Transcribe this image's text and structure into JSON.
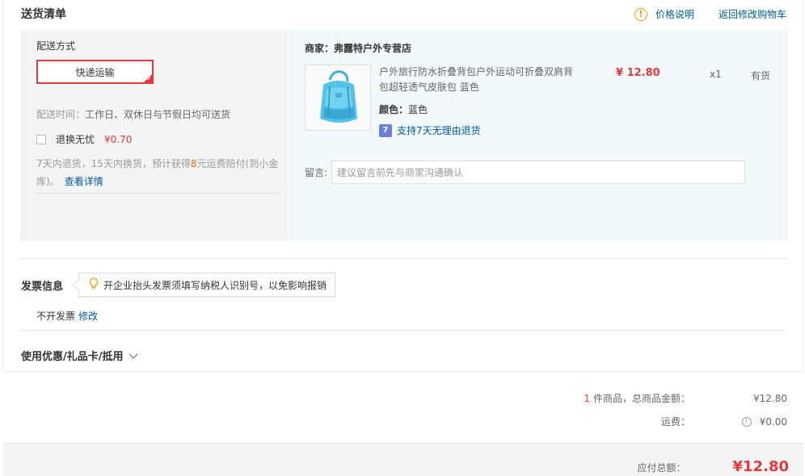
{
  "section": {
    "title": "送货清单",
    "price_info_link": "价格说明",
    "back_to_cart_link": "返回修改购物车"
  },
  "shipping": {
    "method_label": "配送方式",
    "method_selected": "快递运输",
    "time_label": "配送时间：",
    "time_value": "工作日、双休日与节假日均可送货",
    "insurance_label": "退换无忧",
    "insurance_price": "¥0.70",
    "insurance_desc_prefix": "7天内退货，15天内换货，预计获得",
    "insurance_desc_amount": "8",
    "insurance_desc_suffix": "元运费赔付(到小金库)。",
    "insurance_detail_link": "查看详情"
  },
  "order": {
    "merchant": "商家：弗露特户外专营店",
    "product_name": "户外旅行防水折叠背包户外运动可折叠双肩背包超轻透气皮肤包 蓝色",
    "color_label": "颜色：",
    "color_value": "蓝色",
    "return_policy_icon": "7",
    "return_policy": "支持7天无理由退货",
    "price": "¥ 12.80",
    "quantity": "x1",
    "stock": "有货",
    "message_label": "留言:",
    "message_placeholder": "建议留言前先与商家沟通确认"
  },
  "invoice": {
    "title": "发票信息",
    "tip": "开企业抬头发票须填写纳税人识别号，以免影响报销",
    "value": "不开发票",
    "edit_link": "修改"
  },
  "coupon": {
    "label": "使用优惠/礼品卡/抵用"
  },
  "summary": {
    "item_count": "1",
    "item_total_label": "件商品，总商品金额：",
    "item_total_value": "¥12.80",
    "shipping_label": "运费：",
    "shipping_value": "¥0.00",
    "pay_label": "应付总额：",
    "pay_value": "¥12.80"
  },
  "colors": {
    "accent_red": "#e4393c",
    "link_blue": "#005aa0",
    "backpack_blue": "#4fc3e8"
  }
}
